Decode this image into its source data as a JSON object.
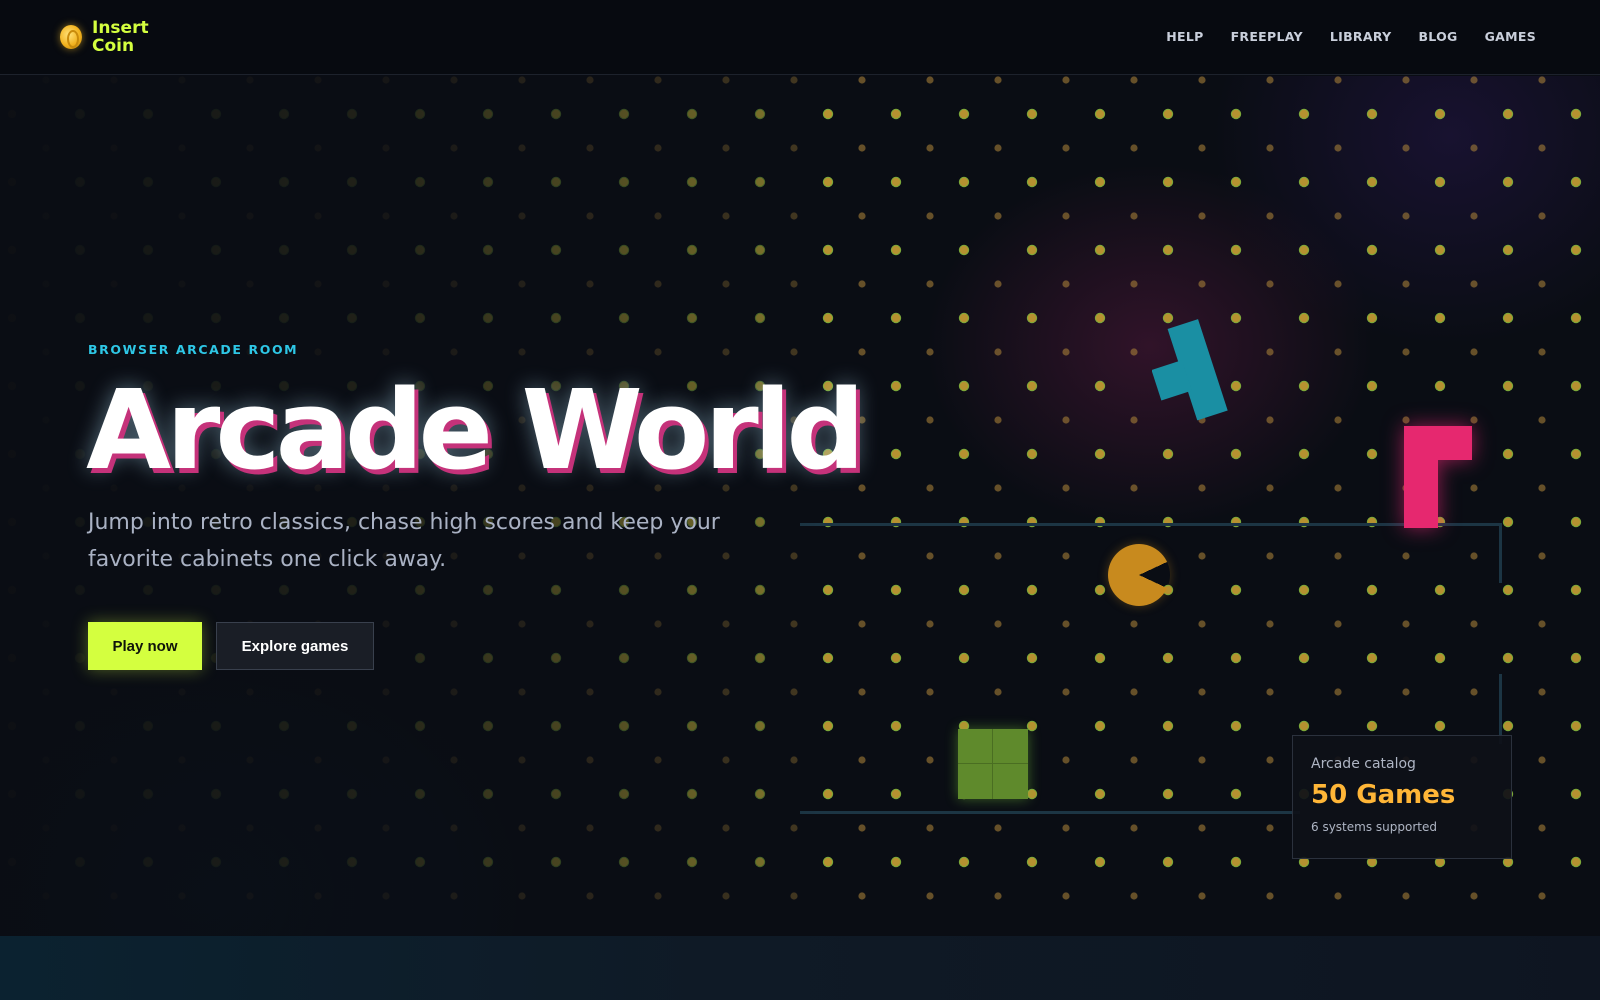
{
  "brand": {
    "name": "Insert Coin",
    "icon": "coin-icon"
  },
  "nav": {
    "items": [
      {
        "label": "HELP"
      },
      {
        "label": "FREEPLAY"
      },
      {
        "label": "LIBRARY"
      },
      {
        "label": "BLOG"
      },
      {
        "label": "GAMES"
      }
    ]
  },
  "hero": {
    "eyebrow": "BROWSER ARCADE ROOM",
    "title": "Arcade World",
    "lede": "Jump into retro classics, chase high scores and keep your favorite cabinets one click away.",
    "primary_cta": "Play now",
    "secondary_cta": "Explore games"
  },
  "catalog": {
    "label": "Arcade catalog",
    "value": "50 Games",
    "sub": "6 systems supported"
  },
  "colors": {
    "accent": "#d4ff3f",
    "cyan": "#2ec7e6",
    "pink": "#e6286f",
    "orange": "#ffb637",
    "background": "#0a0d14"
  }
}
